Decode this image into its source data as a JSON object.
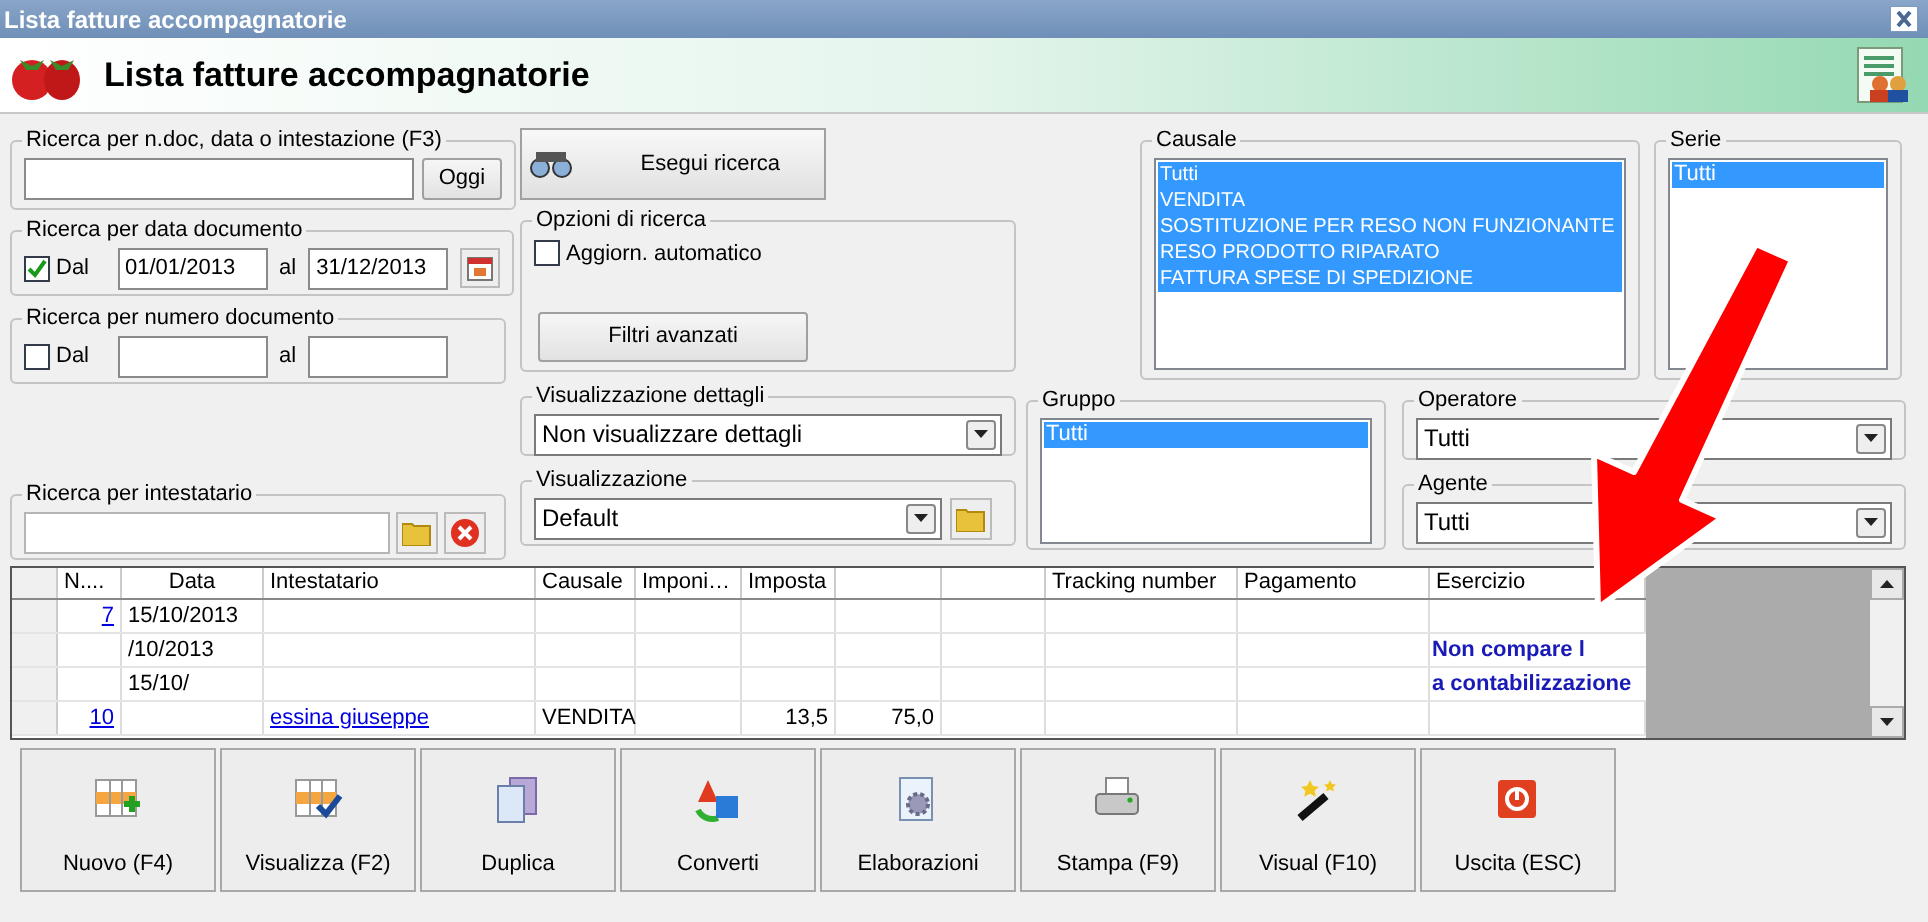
{
  "window": {
    "title": "Lista fatture accompagnatorie"
  },
  "header": {
    "title": "Lista fatture accompagnatorie"
  },
  "search_text": {
    "legend": "Ricerca per n.doc, data o intestazione (F3)",
    "button": "Oggi"
  },
  "search_date": {
    "legend": "Ricerca per data documento",
    "checkbox": {
      "label": "Dal",
      "checked": true
    },
    "from": "01/01/2013",
    "to_label": "al",
    "to": "31/12/2013"
  },
  "search_number": {
    "legend": "Ricerca per numero documento",
    "checkbox": {
      "label": "Dal",
      "checked": false
    },
    "to_label": "al"
  },
  "search_holder": {
    "legend": "Ricerca per intestatario"
  },
  "run_search": {
    "label": "Esegui ricerca"
  },
  "options": {
    "legend": "Opzioni di ricerca",
    "auto_update": {
      "label": "Aggiorn. automatico",
      "checked": false
    },
    "button": "Filtri avanzati"
  },
  "details_view": {
    "legend": "Visualizzazione dettagli",
    "value": "Non visualizzare dettagli"
  },
  "view": {
    "legend": "Visualizzazione",
    "value": "Default"
  },
  "causale": {
    "legend": "Causale",
    "items": [
      {
        "label": "Tutti",
        "selected": true
      },
      {
        "label": "VENDITA",
        "selected": true
      },
      {
        "label": "SOSTITUZIONE PER RESO NON FUNZIONANTE",
        "selected": true
      },
      {
        "label": "RESO PRODOTTO RIPARATO",
        "selected": true
      },
      {
        "label": "FATTURA SPESE DI SPEDIZIONE",
        "selected": true
      }
    ]
  },
  "serie": {
    "legend": "Serie",
    "items": [
      {
        "label": "Tutti",
        "selected": true
      }
    ]
  },
  "gruppo": {
    "legend": "Gruppo",
    "items": [
      {
        "label": "Tutti",
        "selected": true
      }
    ]
  },
  "operatore": {
    "legend": "Operatore",
    "value": "Tutti"
  },
  "agente": {
    "legend": "Agente",
    "value": "Tutti"
  },
  "table": {
    "columns": [
      {
        "label": "N...."
      },
      {
        "label": "Data"
      },
      {
        "label": "Intestatario"
      },
      {
        "label": "Causale"
      },
      {
        "label": "Imponi…"
      },
      {
        "label": "Imposta"
      },
      {},
      {},
      {
        "label": "Tracking number"
      },
      {
        "label": "Pagamento"
      },
      {
        "label": "Esercizio"
      }
    ],
    "rows": [
      {
        "cells": [
          "7",
          "15/10/2013",
          null,
          null,
          null,
          null,
          null,
          null,
          null,
          null,
          null
        ]
      },
      {
        "cells": [
          null,
          "/10/2013",
          null,
          null,
          null,
          null,
          null,
          null,
          null,
          null,
          null
        ]
      },
      {
        "cells": [
          null,
          "15/10/",
          null,
          null,
          null,
          null,
          null,
          null,
          null,
          null,
          null
        ]
      },
      {
        "cells": [
          "10",
          null,
          "essina giuseppe",
          "VENDITA",
          null,
          "13,5",
          "75,0",
          null,
          null,
          null,
          null
        ]
      }
    ]
  },
  "annotation": {
    "lines": [
      "Non compare l",
      "a contabilizzazione"
    ]
  },
  "buttons": [
    {
      "label": "Nuovo (F4)",
      "kind": "new"
    },
    {
      "label": "Visualizza (F2)",
      "kind": "view"
    },
    {
      "label": "Duplica",
      "kind": "duplicate"
    },
    {
      "label": "Converti",
      "kind": "convert"
    },
    {
      "label": "Elaborazioni",
      "kind": "process"
    },
    {
      "label": "Stampa (F9)",
      "kind": "print"
    },
    {
      "label": "Visual (F10)",
      "kind": "visual"
    },
    {
      "label": "Uscita (ESC)",
      "kind": "exit"
    }
  ]
}
